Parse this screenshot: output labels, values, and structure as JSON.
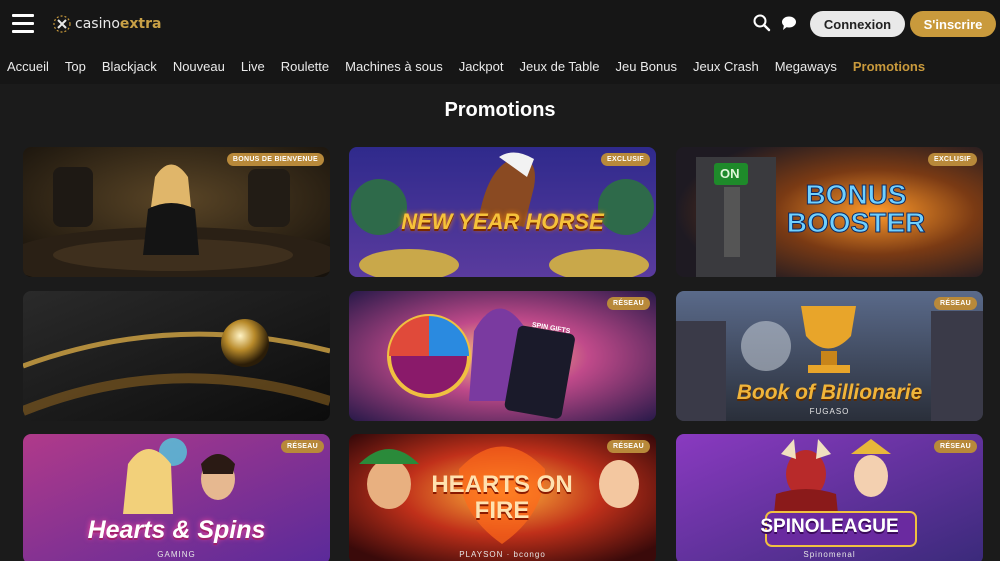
{
  "header": {
    "logo_light": "casino",
    "logo_bold": "extra",
    "login_label": "Connexion",
    "signup_label": "S'inscrire",
    "icons": {
      "menu": "hamburger-menu-icon",
      "search": "search-icon",
      "chat": "chat-bubble-icon",
      "logo": "casino-extra-logo-icon"
    }
  },
  "nav": {
    "items": [
      "Accueil",
      "Top",
      "Blackjack",
      "Nouveau",
      "Live",
      "Roulette",
      "Machines à sous",
      "Jackpot",
      "Jeux de Table",
      "Jeu Bonus",
      "Jeux Crash",
      "Megaways",
      "Promotions"
    ],
    "active_index": 12
  },
  "main": {
    "title": "Promotions",
    "cards": [
      {
        "badge": "BONUS DE BIENVENUE",
        "art_title": "",
        "art_sub": ""
      },
      {
        "badge": "EXCLUSIF",
        "art_title": "NEW YEAR HORSE",
        "art_sub": ""
      },
      {
        "badge": "EXCLUSIF",
        "art_title": "BONUS BOOSTER",
        "art_sub": "ON"
      },
      {
        "badge": "",
        "art_title": "",
        "art_sub": ""
      },
      {
        "badge": "RÉSEAU",
        "art_title": "",
        "art_sub": "SPIN GIFTS"
      },
      {
        "badge": "RÉSEAU",
        "art_title": "Book of Billionarie",
        "art_sub": "FUGASO"
      },
      {
        "badge": "RÉSEAU",
        "art_title": "Hearts & Spins",
        "art_sub": "GAMING"
      },
      {
        "badge": "RÉSEAU",
        "art_title": "HEARTS ON FIRE",
        "art_sub": "PLAYSON · bcongo"
      },
      {
        "badge": "RÉSEAU",
        "art_title": "SPINOLEAGUE",
        "art_sub": "Spinomenal"
      }
    ]
  },
  "colors": {
    "accent": "#c99a3c",
    "background": "#1b1b1b",
    "bar": "#161616",
    "badge": "#b8893a"
  }
}
